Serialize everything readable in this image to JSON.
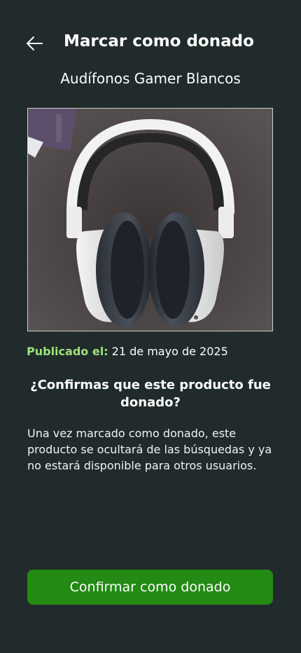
{
  "header": {
    "title": "Marcar como donado",
    "back_icon": "arrow-left-icon"
  },
  "product": {
    "name": "Audífonos Gamer Blancos",
    "image_description": "white-over-ear-headphones-photo"
  },
  "published": {
    "label": "Publicado el:",
    "date": "21 de mayo de 2025"
  },
  "confirmation": {
    "question": "¿Confirmas que este producto fue donado?",
    "description": "Una vez marcado como donado, este producto se ocultará de las búsquedas y ya no estará disponible para otros usuarios."
  },
  "actions": {
    "confirm_label": "Confirmar como donado"
  },
  "colors": {
    "background": "#212b2b",
    "accent_green": "#9de27b",
    "button_green": "#238a14"
  }
}
